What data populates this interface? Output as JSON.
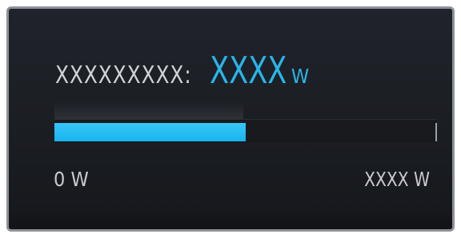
{
  "power": {
    "label": "XXXXXXXXX:",
    "value": "XXXX",
    "unit": "W",
    "fill_fraction": 0.5
  },
  "scale": {
    "min_label": "0 W",
    "max_label": "XXXX W"
  },
  "colors": {
    "accent": "#27b6ea",
    "panel_background": "#1d2025",
    "text": "#cfd3d8",
    "border": "#8f9298"
  }
}
